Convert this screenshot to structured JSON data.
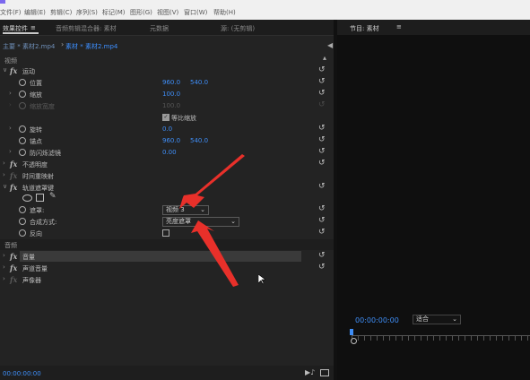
{
  "menu": {
    "items": [
      "文件(F)",
      "编辑(E)",
      "剪辑(C)",
      "序列(S)",
      "标记(M)",
      "图形(G)",
      "视图(V)",
      "窗口(W)",
      "帮助(H)"
    ]
  },
  "tabs": {
    "effect_controls": "效果控件",
    "menu_icon": "≡",
    "audio_mixer": "音频剪辑混合器: 素材",
    "metadata": "元数据",
    "source": "源: (无剪辑)"
  },
  "clip": {
    "source": "主要 * 素材2.mp4",
    "current": "素材 * 素材2.mp4"
  },
  "sections": {
    "video": "视频",
    "audio": "音频"
  },
  "props": {
    "motion": "运动",
    "position": "位置",
    "position_x": "960.0",
    "position_y": "540.0",
    "scale": "缩放",
    "scale_val": "100.0",
    "scale_width": "缩放宽度",
    "scale_width_val": "100.0",
    "uniform_scale": "等比缩放",
    "rotation": "旋转",
    "rotation_val": "0.0",
    "anchor": "锚点",
    "anchor_x": "960.0",
    "anchor_y": "540.0",
    "antiflicker": "防闪烁滤镜",
    "antiflicker_val": "0.00",
    "opacity": "不透明度",
    "time_remap": "时间重映射",
    "track_matte": "轨道遮罩键",
    "matte": "遮罩:",
    "matte_val": "视频 3",
    "composite": "合成方式:",
    "composite_val": "亮度遮罩",
    "reverse": "反向",
    "volume": "音量",
    "channel_volume": "声道音量",
    "panner": "声像器"
  },
  "program": {
    "title": "节目: 素材",
    "timecode": "00:00:00:00",
    "zoom": "适合"
  },
  "status": {
    "timecode": "00:00:00:00"
  },
  "colors": {
    "accent_blue": "#3f8ef7",
    "arrow_red": "#e8302a"
  }
}
